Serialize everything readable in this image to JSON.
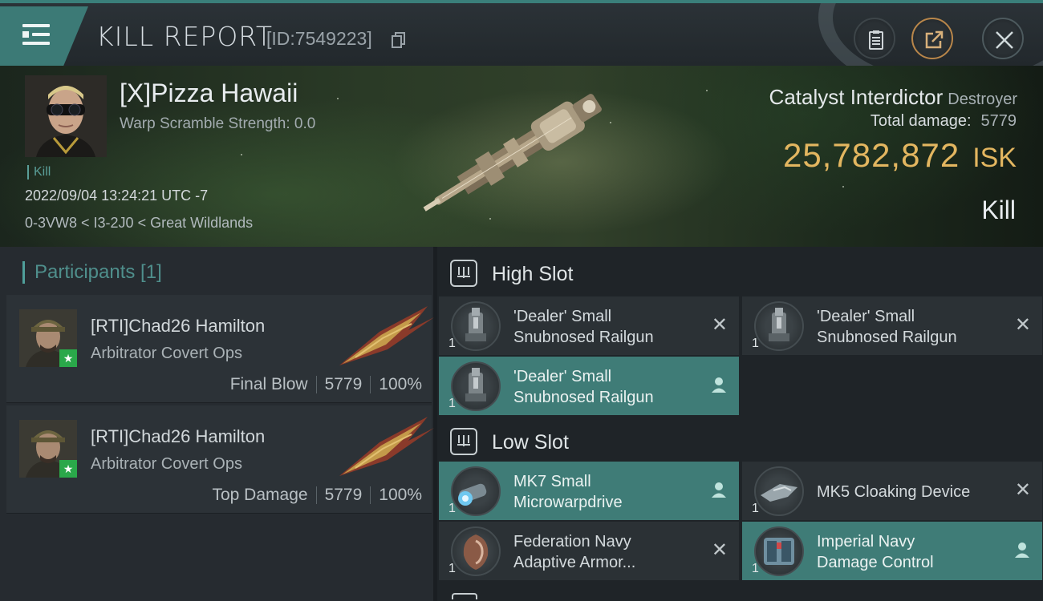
{
  "header": {
    "title": "KILL REPORT",
    "id_text": "[ID:7549223]",
    "icons": [
      "menu-icon",
      "copy-icon",
      "clipboard-icon",
      "share-icon",
      "close-icon"
    ]
  },
  "victim": {
    "name": "[X]Pizza Hawaii",
    "warp_scramble": "Warp Scramble Strength: 0.0",
    "tag": "Kill",
    "datetime": "2022/09/04 13:24:21 UTC -7",
    "location": "0-3VW8 < I3-2J0 < Great Wildlands"
  },
  "ship": {
    "name": "Catalyst Interdictor",
    "class": "Destroyer",
    "total_damage_label": "Total damage:",
    "total_damage": "5779",
    "isk_value": "25,782,872",
    "isk_unit": "ISK",
    "result": "Kill"
  },
  "participants": {
    "heading": "Participants [1]",
    "rows": [
      {
        "name": "[RTI]Chad26 Hamilton",
        "ship": "Arbitrator Covert Ops",
        "role": "Final Blow",
        "damage": "5779",
        "percent": "100%"
      },
      {
        "name": "[RTI]Chad26 Hamilton",
        "ship": "Arbitrator Covert Ops",
        "role": "Top Damage",
        "damage": "5779",
        "percent": "100%"
      }
    ]
  },
  "fitting": {
    "high_slot": {
      "label": "High Slot",
      "modules": [
        {
          "line1": "'Dealer' Small",
          "line2": "Snubnosed Railgun",
          "qty": "1",
          "state": "destroyed"
        },
        {
          "line1": "'Dealer' Small",
          "line2": "Snubnosed Railgun",
          "qty": "1",
          "state": "destroyed"
        },
        {
          "line1": "'Dealer' Small",
          "line2": "Snubnosed Railgun",
          "qty": "1",
          "state": "dropped"
        }
      ]
    },
    "low_slot": {
      "label": "Low Slot",
      "modules": [
        {
          "line1": "MK7 Small",
          "line2": "Microwarpdrive",
          "qty": "1",
          "state": "dropped"
        },
        {
          "line1": "MK5 Cloaking Device",
          "line2": "",
          "qty": "1",
          "state": "destroyed"
        },
        {
          "line1": "Federation Navy",
          "line2": "Adaptive Armor...",
          "qty": "1",
          "state": "destroyed"
        },
        {
          "line1": "Imperial Navy",
          "line2": "Damage Control",
          "qty": "1",
          "state": "dropped"
        }
      ]
    }
  },
  "colors": {
    "accent_teal": "#3f7c77",
    "isk_gold": "#e3b660",
    "star_green": "#2aa84a"
  }
}
